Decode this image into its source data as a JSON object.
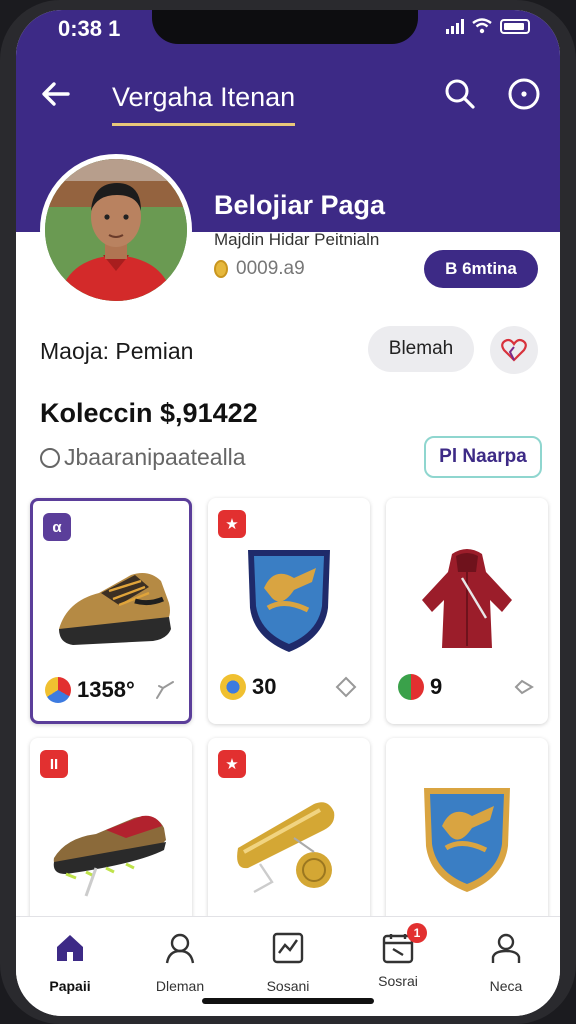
{
  "status": {
    "time": "0:38 1"
  },
  "header": {
    "title": "Vergaha Itenan"
  },
  "profile": {
    "name": "Belojiar Paga",
    "subtitle": "Majdin Hidar Peitnialn",
    "coins": "0009.a9",
    "follow_label": "B 6mtina"
  },
  "actions": {
    "role_label": "Maoja: Pemian",
    "chip_label": "Blemah"
  },
  "collection": {
    "title": "Koleccin $,91422",
    "handle": "Jbaaranipaatealla",
    "badge_label": "Pl Naarpa"
  },
  "items": [
    {
      "badge": "α",
      "badge_color": "#5b3e9a",
      "value": "1358°",
      "item": "sneaker",
      "selected": true
    },
    {
      "badge": "★",
      "badge_color": "#e23030",
      "value": "30",
      "item": "crest"
    },
    {
      "badge": "",
      "badge_color": "",
      "value": "9",
      "item": "jacket"
    },
    {
      "badge": "II",
      "badge_color": "#e23030",
      "value": "",
      "item": "boot"
    },
    {
      "badge": "★",
      "badge_color": "#e23030",
      "value": "",
      "item": "whistle"
    },
    {
      "badge": "",
      "badge_color": "",
      "value": "",
      "item": "crest"
    }
  ],
  "tabs": [
    {
      "label": "Papaii",
      "icon": "home-icon",
      "active": true
    },
    {
      "label": "Dleman",
      "icon": "user-icon"
    },
    {
      "label": "Sosani",
      "icon": "chart-icon"
    },
    {
      "label": "Sosrai",
      "icon": "calendar-icon",
      "badge": "1"
    },
    {
      "label": "Neca",
      "icon": "profile-icon"
    }
  ],
  "colors": {
    "primary": "#3d2a86",
    "accent": "#e9c77a",
    "alert": "#e23030"
  }
}
